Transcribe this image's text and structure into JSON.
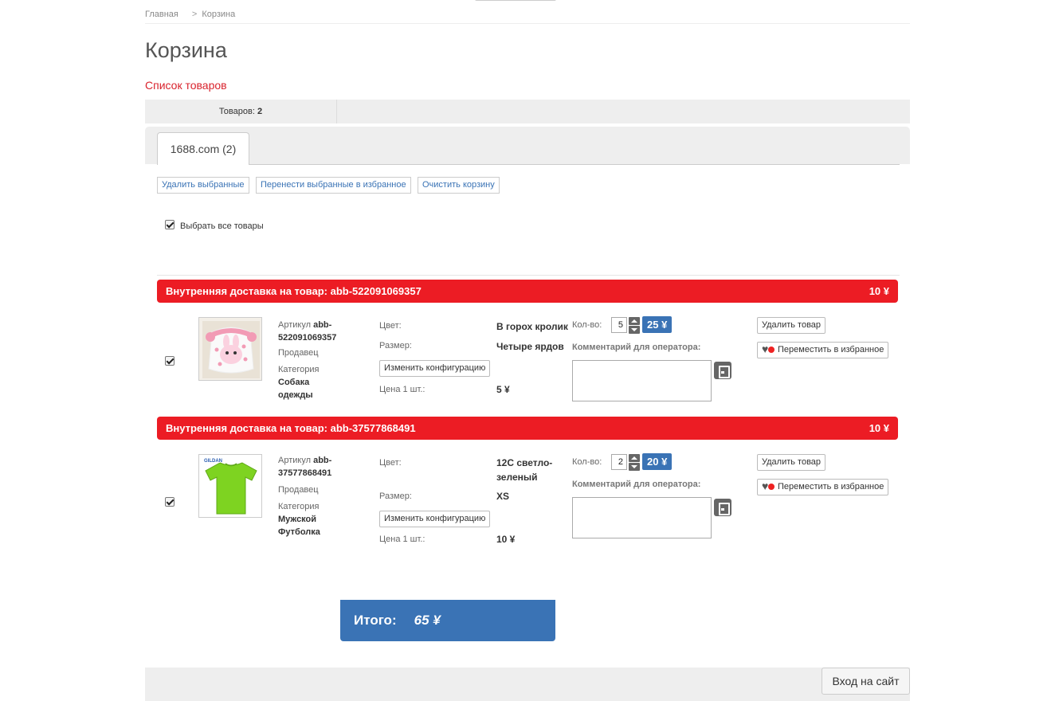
{
  "breadcrumb": {
    "home": "Главная",
    "separator": ">",
    "current": "Корзина"
  },
  "page_title": "Корзина",
  "list_title": "Список товаров",
  "count_bar": {
    "label": "Товаров:",
    "value": "2"
  },
  "tabs": [
    {
      "label": "1688.com (2)"
    }
  ],
  "actions": {
    "delete_selected": "Удалить выбранные",
    "move_selected": "Перенести выбранные в избранное",
    "clear_cart": "Очистить корзину"
  },
  "select_all_label": "Выбрать все товары",
  "labels": {
    "article": "Артикул",
    "seller": "Продавец",
    "category": "Категория",
    "color": "Цвет:",
    "size": "Размер:",
    "change_config": "Изменить конфигурацию",
    "unit_price": "Цена 1 шт.:",
    "qty": "Кол-во:",
    "comment": "Комментарий для оператора:",
    "delete_item": "Удалить товар",
    "move_fav": "Переместить в избранное"
  },
  "items": [
    {
      "shipping_label": "Внутренняя доставка на товар: abb-522091069357",
      "shipping_price": "10 ¥",
      "article": "abb-522091069357",
      "category": "Собака одежды",
      "color": "В горох кролик",
      "size": "Четыре ярдов",
      "unit_price": "5 ¥",
      "qty": "5",
      "sum": "25 ¥"
    },
    {
      "shipping_label": "Внутренняя доставка на товар: abb-37577868491",
      "shipping_price": "10 ¥",
      "article": "abb-37577868491",
      "category": "Мужской Футболка",
      "color": "12C светло-зеленый",
      "size": "XS",
      "unit_price": "10 ¥",
      "qty": "2",
      "sum": "20 ¥"
    }
  ],
  "total": {
    "label": "Итого:",
    "amount": "65 ¥"
  },
  "login_button": "Вход на сайт",
  "thumb_text": "GILDAN",
  "colors": {
    "accent_red": "#ec1c24",
    "accent_blue": "#3a73b5",
    "link_red": "#d9232d"
  }
}
